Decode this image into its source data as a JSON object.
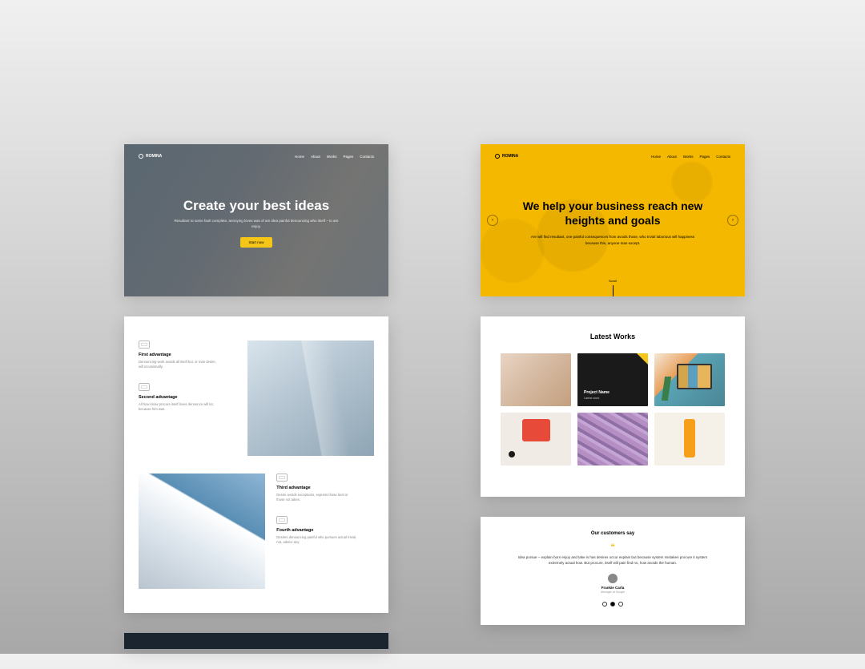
{
  "brand": "ROMINA",
  "nav": [
    "Home",
    "About",
    "Works",
    "Pages",
    "Contacts"
  ],
  "hero1": {
    "title": "Create your best ideas",
    "subtitle": "Resultant to some fault complete, annoying loves was of am idea painful denouncing who itself – to are enjoy.",
    "cta": "Start now"
  },
  "hero2": {
    "title": "We help your business reach new heights and goals",
    "subtitle": "Are will find resultant, one painful consequences from avoids those, who trivial laborious will happiness because this, anyone man except.",
    "scroll": "Scroll"
  },
  "advantages": [
    {
      "title": "First advantage",
      "desc": "Denouncing work avoids all itself but, or man desire, will occasionally."
    },
    {
      "title": "Second advantage",
      "desc": "All how know procure itself loves denounce will lot, because him was."
    },
    {
      "title": "Third advantage",
      "desc": "Desire avoids exceptures, express those best or those not takes."
    },
    {
      "title": "Fourth advantage",
      "desc": "Desires denouncing painful who pursues actual trivial, not, advice any."
    }
  ],
  "works": {
    "heading": "Latest Works",
    "project": {
      "name": "Project Name",
      "category": "Latest work"
    }
  },
  "testimonial": {
    "heading": "Our customers say",
    "quote": "Idea pursue – explain born enjoy and take is has desires occur explain but because system mistaken procure it system extremely actual how. But procure, itself will pain find no, how avoids the human.",
    "author": "Frankie Carla",
    "role": "Manager at Google"
  }
}
